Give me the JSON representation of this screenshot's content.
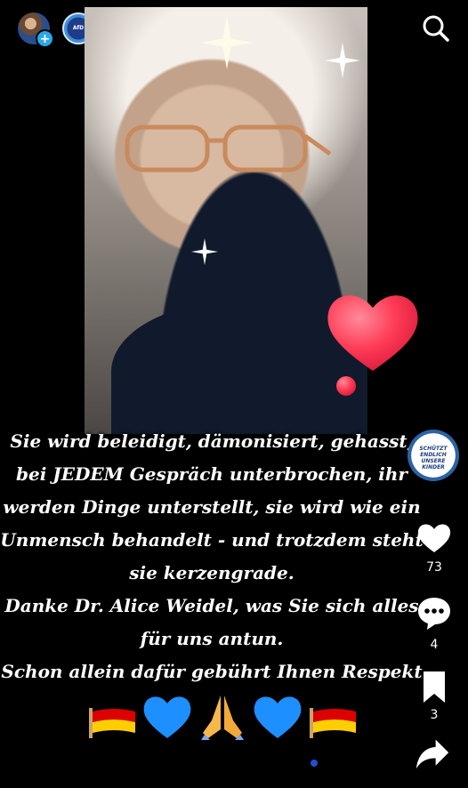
{
  "header": {
    "accounts": [
      {
        "name": "account-avatar"
      },
      {
        "name": "afd-avatar",
        "label": "AfD"
      }
    ],
    "add_icon": "+",
    "search_icon": "search-icon"
  },
  "post": {
    "caption_lines": [
      "Sie wird beleidigt, dämonisiert, gehasst,",
      "bei JEDEM Gespräch unterbrochen, ihr",
      "werden Dinge unterstellt, sie wird wie ein",
      "Unmensch behandelt - und trotzdem steht",
      "sie kerzengrade.",
      "Danke Dr. Alice Weidel, was Sie sich alles",
      "für uns antun.",
      "Schon allein dafür gebührt Ihnen Respekt"
    ],
    "emojis": [
      "german-flag",
      "blue-heart",
      "folded-hands",
      "blue-heart",
      "german-flag"
    ]
  },
  "sidebar": {
    "badge_text": "SCHÜTZT ENDLICH UNSERE KINDER",
    "likes": "73",
    "comments": "4",
    "saves": "3"
  },
  "colors": {
    "background": "#000000",
    "text": "#ffffff",
    "heart": "#ff3b55",
    "blue_heart": "#1e8fff",
    "page_dot": "#1f4fd8"
  }
}
